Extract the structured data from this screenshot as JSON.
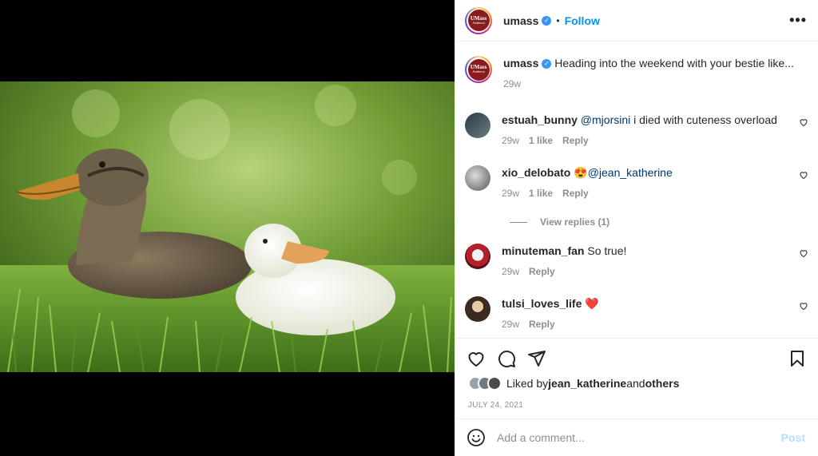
{
  "post": {
    "author": "umass",
    "follow_label": "Follow",
    "more_label": "•••",
    "separator": "•",
    "logo_text_1": "UMass",
    "logo_text_2": "Amherst",
    "caption": "Heading into the weekend with your bestie like...",
    "caption_age": "29w"
  },
  "comments": [
    {
      "user": "estuah_bunny",
      "mention": "@mjorsini",
      "text": " i died with cuteness overload",
      "age": "29w",
      "likes": "1 like",
      "reply": "Reply"
    },
    {
      "user": "xio_delobato",
      "emoji": "😍",
      "mention": "@jean_katherine",
      "text": "",
      "age": "29w",
      "likes": "1 like",
      "reply": "Reply"
    },
    {
      "user": "minuteman_fan",
      "text": "So true!",
      "age": "29w",
      "reply": "Reply"
    },
    {
      "user": "tulsi_loves_life",
      "text": "❤️",
      "age": "29w",
      "reply": "Reply"
    }
  ],
  "view_replies": "View replies (1)",
  "likes": {
    "prefix": "Liked by ",
    "user": "jean_katherine",
    "middle": " and ",
    "others": "others"
  },
  "date": "JULY 24, 2021",
  "add_comment": {
    "placeholder": "Add a comment...",
    "post_label": "Post"
  },
  "icons": [
    "heart-icon",
    "comment-icon",
    "share-icon",
    "bookmark-icon",
    "emoji-icon",
    "verified-icon",
    "more-icon"
  ],
  "colors": {
    "link": "#0095f6",
    "mention": "#00376b",
    "muted": "#8e8e8e",
    "brand": "#881c1c"
  }
}
